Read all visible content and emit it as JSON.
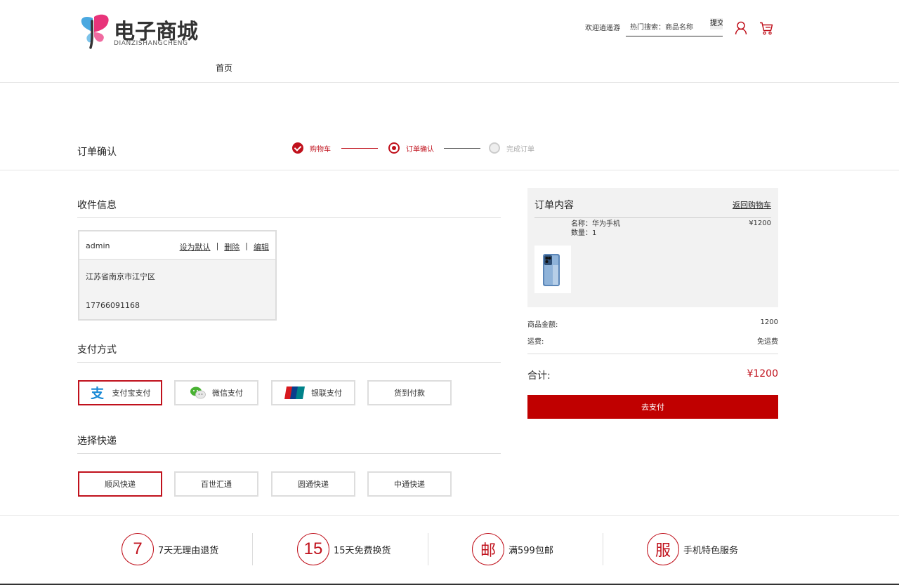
{
  "header": {
    "logo_title": "电子商城",
    "logo_sub": "DIANZISHANGCHENG",
    "welcome": "欢迎逍遥游",
    "search_placeholder": "热门搜索：商品名称",
    "search_button": "提交",
    "user_icon": "user-icon",
    "cart_icon": "cart-icon"
  },
  "nav": {
    "home": "首页"
  },
  "page_title": "订单确认",
  "steps": [
    {
      "label": "购物车",
      "state": "done"
    },
    {
      "label": "订单确认",
      "state": "current"
    },
    {
      "label": "完成订单",
      "state": "todo"
    }
  ],
  "shipping_info": {
    "title": "收件信息",
    "name": "admin",
    "actions": [
      "设为默认",
      "删除",
      "编辑"
    ],
    "separator": "|",
    "address": "江苏省南京市江宁区",
    "phone": "17766091168"
  },
  "payment": {
    "title": "支付方式",
    "options": [
      {
        "label": "支付宝支付",
        "icon": "alipay-icon",
        "selected": true
      },
      {
        "label": "微信支付",
        "icon": "wechat-icon",
        "selected": false
      },
      {
        "label": "银联支付",
        "icon": "unionpay-icon",
        "selected": false
      },
      {
        "label": "货到付款",
        "icon": "",
        "selected": false
      }
    ]
  },
  "delivery": {
    "title": "选择快递",
    "options": [
      {
        "label": "顺风快递",
        "selected": true
      },
      {
        "label": "百世汇通",
        "selected": false
      },
      {
        "label": "圆通快递",
        "selected": false
      },
      {
        "label": "中通快递",
        "selected": false
      }
    ]
  },
  "order": {
    "title": "订单内容",
    "back_link": "返回购物车",
    "product_name": "名称：华为手机",
    "product_qty": "数量：1",
    "product_price": "¥1200",
    "subtotal_label": "商品金额:",
    "subtotal_value": "1200",
    "shipping_label": "运费:",
    "shipping_value": "免运费",
    "total_label": "合计:",
    "total_value": "¥1200",
    "pay_button": "去支付"
  },
  "footer_services": [
    {
      "badge": "7",
      "text": "7天无理由退货"
    },
    {
      "badge": "15",
      "text": "15天免费换货"
    },
    {
      "badge": "邮",
      "text": "满599包邮"
    },
    {
      "badge": "服",
      "text": "手机特色服务"
    }
  ],
  "colors": {
    "accent": "#c0111c",
    "button": "#c00000"
  }
}
